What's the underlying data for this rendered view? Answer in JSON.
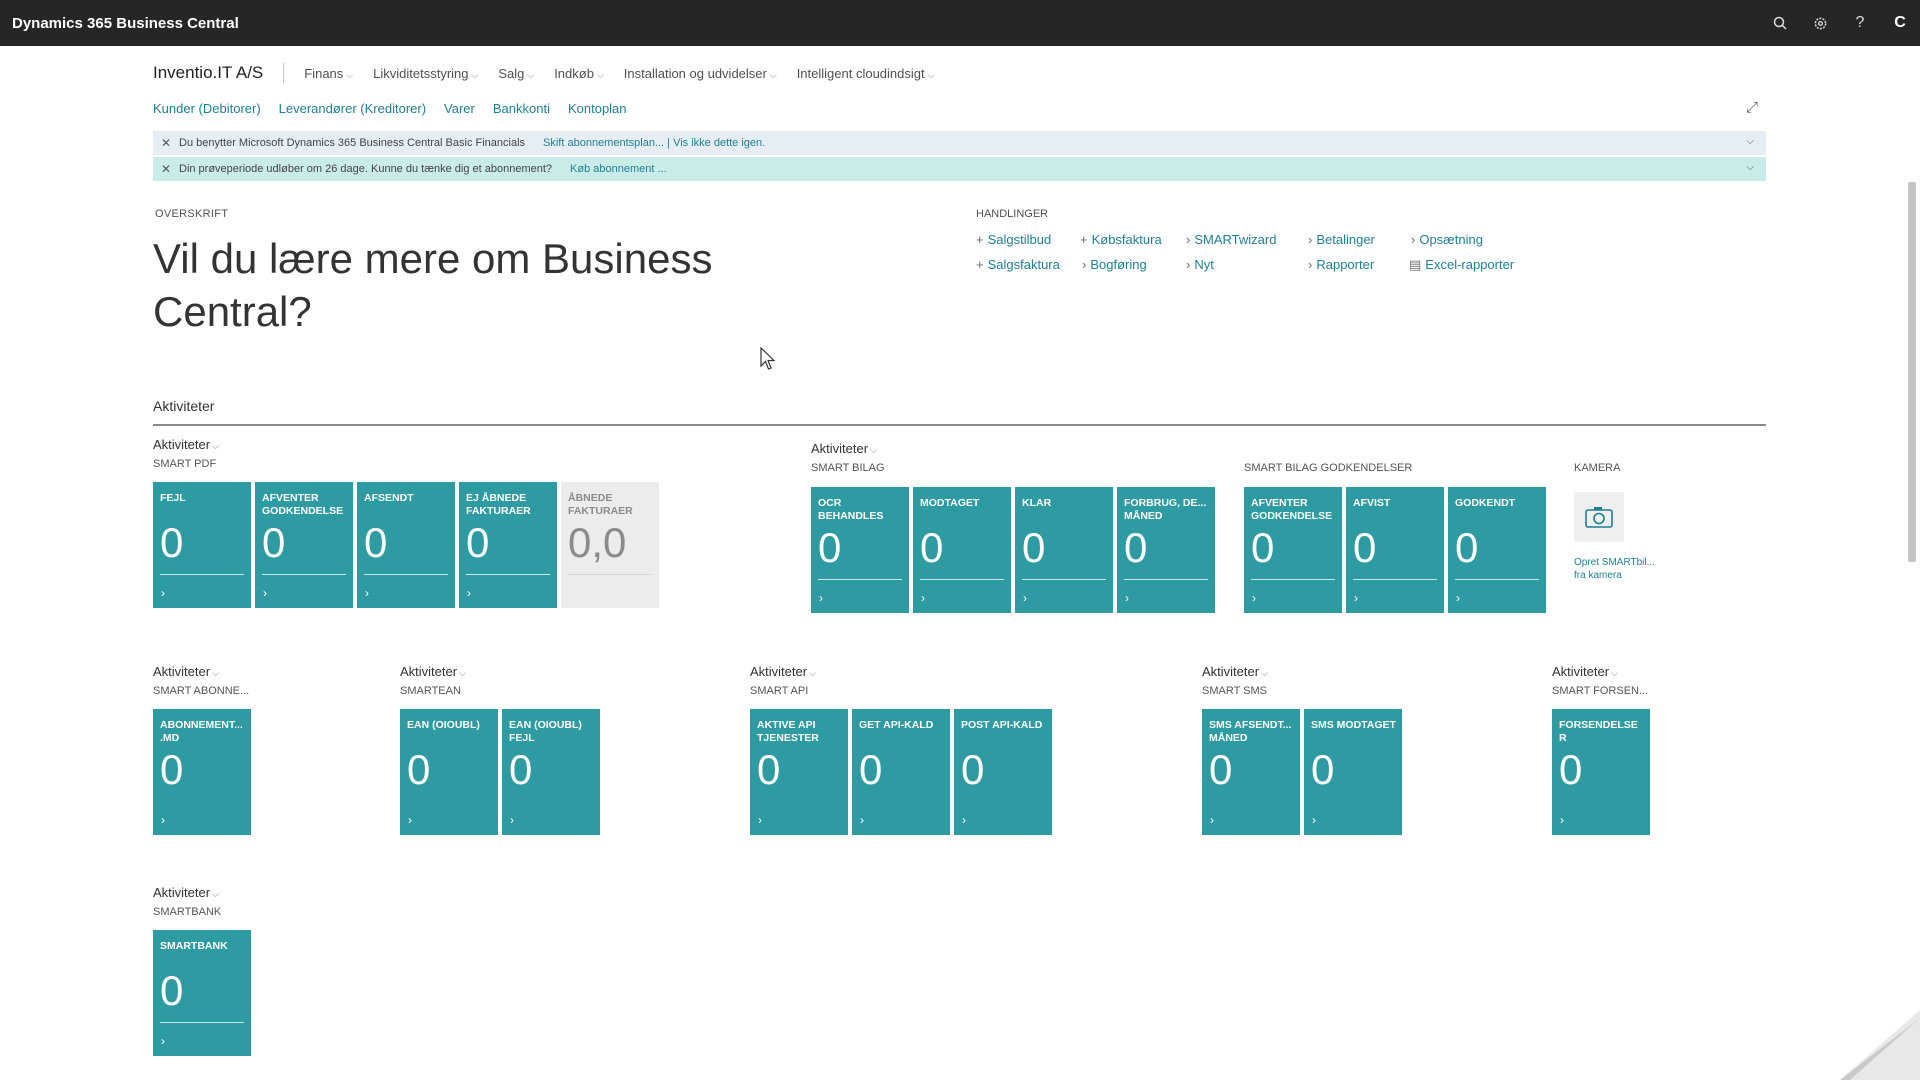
{
  "app_title": "Dynamics 365 Business Central",
  "topbar_icons": [
    "search-icon",
    "gear-icon",
    "help-icon"
  ],
  "user_initial": "C",
  "company": "Inventio.IT A/S",
  "menu": [
    "Finans",
    "Likviditetsstyring",
    "Salg",
    "Indkøb",
    "Installation og udvidelser",
    "Intelligent cloudindsigt"
  ],
  "links": [
    "Kunder (Debitorer)",
    "Leverandører (Kreditorer)",
    "Varer",
    "Bankkonti",
    "Kontoplan"
  ],
  "banners": [
    {
      "text": "Du benytter Microsoft Dynamics 365 Business Central Basic Financials",
      "link": "Skift abonnementsplan... | Vis ikke dette igen."
    },
    {
      "text": "Din prøveperiode udløber om 26 dage. Kunne du tænke dig et abonnement?",
      "link": "Køb abonnement ..."
    }
  ],
  "overskrift": "OVERSKRIFT",
  "headline": "Vil du lære mere om Business Central?",
  "handlinger_title": "HANDLINGER",
  "actions": [
    {
      "label": "Salgstilbud",
      "icon": "+"
    },
    {
      "label": "Salgsfaktura",
      "icon": "+"
    },
    {
      "label": "Købsfaktura",
      "icon": "+"
    },
    {
      "label": "Bogføring",
      "icon": "›"
    },
    {
      "label": "SMARTwizard",
      "icon": "›"
    },
    {
      "label": "Nyt",
      "icon": "›"
    },
    {
      "label": "Betalinger",
      "icon": "›"
    },
    {
      "label": "Rapporter",
      "icon": "›"
    },
    {
      "label": "Opsætning",
      "icon": "›"
    },
    {
      "label": "Excel-rapporter",
      "icon": "▤"
    }
  ],
  "section_title": "Aktiviteter",
  "groups": [
    {
      "label": "Aktiviteter",
      "sub": "SMART PDF",
      "tiles": [
        {
          "label": "FEJL",
          "value": "0"
        },
        {
          "label": "AFVENTER GODKENDELSE",
          "value": "0"
        },
        {
          "label": "AFSENDT",
          "value": "0"
        },
        {
          "label": "EJ ÅBNEDE FAKTURAER",
          "value": "0"
        },
        {
          "label": "ÅBNEDE FAKTURAER",
          "value": "0,0"
        }
      ]
    },
    {
      "label": "Aktiviteter",
      "sub": "SMART BILAG",
      "tiles": [
        {
          "label": "OCR BEHANDLES",
          "value": "0"
        },
        {
          "label": "MODTAGET",
          "value": "0"
        },
        {
          "label": "KLAR",
          "value": "0"
        },
        {
          "label": "FORBRUG, DE... MÅNED",
          "value": "0"
        }
      ]
    },
    {
      "label": "",
      "sub": "SMART BILAG GODKENDELSER",
      "tiles": [
        {
          "label": "AFVENTER GODKENDELSE",
          "value": "0"
        },
        {
          "label": "AFVIST",
          "value": "0"
        },
        {
          "label": "GODKENDT",
          "value": "0"
        }
      ]
    },
    {
      "label": "Aktiviteter",
      "sub": "SMART ABONNE...",
      "tiles": [
        {
          "label": "ABONNEMENT... .MD",
          "value": "0"
        }
      ]
    },
    {
      "label": "Aktiviteter",
      "sub": "SMARTEAN",
      "tiles": [
        {
          "label": "EAN (OIOUBL)",
          "value": "0"
        },
        {
          "label": "EAN (OIOUBL) FEJL",
          "value": "0"
        }
      ]
    },
    {
      "label": "Aktiviteter",
      "sub": "SMART API",
      "tiles": [
        {
          "label": "AKTIVE API TJENESTER",
          "value": "0"
        },
        {
          "label": "GET API-KALD",
          "value": "0"
        },
        {
          "label": "POST API-KALD",
          "value": "0"
        }
      ]
    },
    {
      "label": "Aktiviteter",
      "sub": "SMART SMS",
      "tiles": [
        {
          "label": "SMS AFSENDT... MÅNED",
          "value": "0"
        },
        {
          "label": "SMS MODTAGET",
          "value": "0"
        }
      ]
    },
    {
      "label": "Aktiviteter",
      "sub": "SMART FORSEN...",
      "tiles": [
        {
          "label": "FORSENDELSE R",
          "value": "0"
        }
      ]
    },
    {
      "label": "Aktiviteter",
      "sub": "SMARTBANK",
      "tiles": [
        {
          "label": "SMARTBANK",
          "value": "0"
        }
      ]
    }
  ],
  "camera": {
    "sub": "KAMERA",
    "caption": "Opret SMARTbil... fra kamera"
  },
  "colors": {
    "topbar": "#262626",
    "tile": "#2e9aa1",
    "link": "#1f7f92",
    "banner1": "#e6eef4",
    "banner2": "#c9ece9"
  }
}
